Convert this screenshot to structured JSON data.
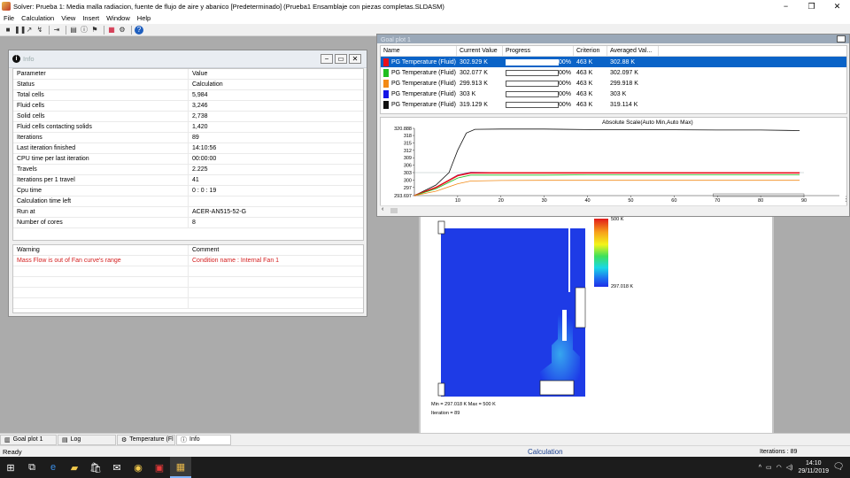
{
  "window": {
    "title": "Solver: Prueba 1: Media malla radiacion, fuente de flujo de aire y abanico [Predeterminado] (Prueba1 Ensamblaje con piezas completas.SLDASM)",
    "minimize": "−",
    "maximize": "❐",
    "close": "✕"
  },
  "menu": [
    "File",
    "Calculation",
    "View",
    "Insert",
    "Window",
    "Help"
  ],
  "toolbar_icons": [
    "stop-icon",
    "pause-icon",
    "arrow-icon",
    "pan-icon",
    "line-icon",
    "document-icon",
    "info-icon",
    "preview-icon",
    "goal-plot-icon",
    "settings-icon",
    "help-icon"
  ],
  "info": {
    "title": "Info",
    "header": {
      "parameter": "Parameter",
      "value": "Value"
    },
    "rows": [
      {
        "p": "Status",
        "v": "Calculation"
      },
      {
        "p": "Total cells",
        "v": "5,984"
      },
      {
        "p": "Fluid cells",
        "v": "3,246"
      },
      {
        "p": "Solid cells",
        "v": "2,738"
      },
      {
        "p": "Fluid cells contacting solids",
        "v": "1,420"
      },
      {
        "p": "Iterations",
        "v": "89"
      },
      {
        "p": "Last iteration finished",
        "v": "14:10:56"
      },
      {
        "p": "CPU time per last iteration",
        "v": "00:00:00"
      },
      {
        "p": "Travels",
        "v": "2.225"
      },
      {
        "p": "Iterations per 1 travel",
        "v": "41"
      },
      {
        "p": "Cpu time",
        "v": "0 : 0 : 19"
      },
      {
        "p": "Calculation time left",
        "v": ""
      },
      {
        "p": "Run at",
        "v": "ACER-AN515-52-G"
      },
      {
        "p": "Number of cores",
        "v": "8"
      }
    ],
    "warn_header": {
      "warning": "Warning",
      "comment": "Comment"
    },
    "warnings": [
      {
        "w": "Mass Flow is out of Fan curve's range",
        "c": "Condition name : Internal Fan 1"
      }
    ]
  },
  "goal": {
    "title": "Goal plot 1",
    "columns": {
      "name": "Name",
      "current": "Current Value",
      "progress": "Progress",
      "criterion": "Criterion",
      "avg": "Averaged Val..."
    },
    "rows": [
      {
        "name": "PG Temperature (Fluid)",
        "current": "302.929 K",
        "progress": 1.0,
        "pct": "00%",
        "criterion": "463 K",
        "avg": "302.88 K",
        "color": "#e8101a"
      },
      {
        "name": "PG Temperature (Fluid)",
        "current": "302.077 K",
        "progress": 1.0,
        "pct": "00%",
        "criterion": "463 K",
        "avg": "302.097 K",
        "color": "#1fbe1f"
      },
      {
        "name": "PG Temperature (Fluid)",
        "current": "299.913 K",
        "progress": 1.0,
        "pct": "00%",
        "criterion": "463 K",
        "avg": "299.918 K",
        "color": "#f28a16"
      },
      {
        "name": "PG Temperature (Fluid)",
        "current": "303 K",
        "progress": 1.0,
        "pct": "00%",
        "criterion": "463 K",
        "avg": "303 K",
        "color": "#1515e6"
      },
      {
        "name": "PG Temperature (Fluid)",
        "current": "319.129 K",
        "progress": 1.0,
        "pct": "00%",
        "criterion": "463 K",
        "avg": "319.114 K",
        "color": "#111111"
      }
    ]
  },
  "chart_data": {
    "type": "line",
    "title": "Absolute Scale(Auto Min,Auto Max)",
    "xlabel": "",
    "ylabel": "",
    "xlim": [
      0,
      90
    ],
    "ylim": [
      293.697,
      320.888
    ],
    "xticks": [
      "10",
      "20",
      "30",
      "40",
      "50",
      "60",
      "70",
      "80",
      "90",
      "1"
    ],
    "yticks": [
      "320.888",
      "318",
      "315",
      "312",
      "309",
      "306",
      "303",
      "300",
      "297",
      "293.697"
    ],
    "grid": false,
    "series": [
      {
        "color": "#111111",
        "x": [
          0,
          5,
          8,
          10,
          12,
          14,
          20,
          30,
          40,
          50,
          60,
          70,
          80,
          89
        ],
        "y": [
          293.7,
          298,
          303,
          312,
          319,
          320.5,
          320.6,
          320.6,
          320.4,
          320.3,
          320.3,
          320.2,
          320.2,
          320.0
        ]
      },
      {
        "color": "#1515e6",
        "x": [
          0,
          5,
          10,
          13,
          20,
          30,
          40,
          50,
          60,
          70,
          80,
          89
        ],
        "y": [
          293.7,
          297,
          302,
          303.1,
          303,
          303,
          303,
          303,
          303,
          303,
          303,
          303
        ]
      },
      {
        "color": "#e8101a",
        "x": [
          0,
          5,
          10,
          13,
          20,
          30,
          40,
          50,
          60,
          70,
          80,
          89
        ],
        "y": [
          293.7,
          297,
          301.8,
          302.9,
          302.9,
          302.9,
          302.9,
          302.9,
          302.9,
          302.9,
          302.9,
          302.9
        ]
      },
      {
        "color": "#1fbe1f",
        "x": [
          0,
          5,
          10,
          13,
          20,
          30,
          40,
          50,
          60,
          70,
          80,
          89
        ],
        "y": [
          293.7,
          296.5,
          300.8,
          302.0,
          302.0,
          302.0,
          302.1,
          302.1,
          302.1,
          302.1,
          302.1,
          302.1
        ]
      },
      {
        "color": "#f28a16",
        "x": [
          0,
          5,
          10,
          13,
          20,
          30,
          40,
          50,
          60,
          70,
          80,
          89
        ],
        "y": [
          293.7,
          295.5,
          298.5,
          299.6,
          299.8,
          299.9,
          299.9,
          299.9,
          299.9,
          299.9,
          299.9,
          299.9
        ]
      }
    ]
  },
  "temp": {
    "max_label": "500 K",
    "min_label": "297.018 K",
    "minmax": "Min = 297.018 K   Max = 500 K",
    "iteration": "Iteration = 89"
  },
  "tabs": [
    {
      "label": "Goal plot 1",
      "icon": "graph-icon",
      "active": false
    },
    {
      "label": "Log",
      "icon": "log-icon",
      "active": false
    },
    {
      "label": "Temperature (Fl",
      "icon": "temperature-icon",
      "active": false
    },
    {
      "label": "Info",
      "icon": "info-icon",
      "active": true
    }
  ],
  "status": {
    "ready": "Ready",
    "calc": "Calculation",
    "iterations": "Iterations : 89"
  },
  "taskbar": {
    "time": "14:10",
    "date": "29/11/2019",
    "apps": [
      "windows-icon",
      "task-view-icon",
      "edge-icon",
      "explorer-icon",
      "store-icon",
      "mail-icon",
      "chrome-icon",
      "solidworks-icon",
      "flow-simulation-icon"
    ]
  }
}
